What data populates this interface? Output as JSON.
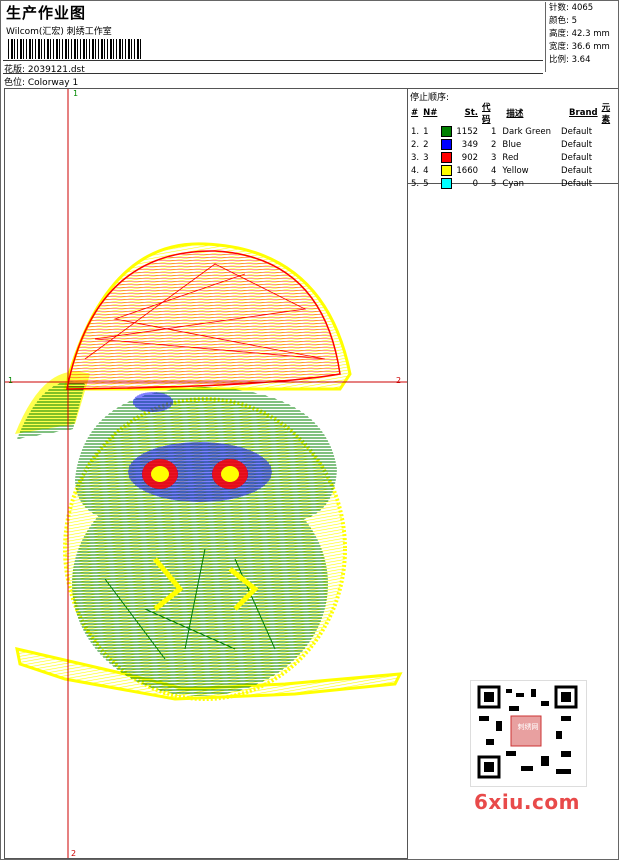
{
  "header": {
    "title": "生产作业图",
    "company": "Wilcom(汇宏) 刺绣工作室",
    "file_label": "花版: 2039121.dst",
    "colorway_label": "色位: Colorway 1"
  },
  "stats": {
    "stitches": "针数: 4065",
    "colors": "颜色: 5",
    "height": "高度: 42.3 mm",
    "width": "宽度: 36.6 mm",
    "scale": "比例: 3.64"
  },
  "stop_sequence": {
    "title": "停止顺序:",
    "headers": [
      "#",
      "N#",
      "St.",
      "代码",
      "描述",
      "Brand",
      "元素"
    ],
    "rows": [
      {
        "idx": "1.",
        "n": "1",
        "color": "#008000",
        "st": "1152",
        "code": "1",
        "desc": "Dark Green",
        "brand": "Default"
      },
      {
        "idx": "2.",
        "n": "2",
        "color": "#0000ff",
        "st": "349",
        "code": "2",
        "desc": "Blue",
        "brand": "Default"
      },
      {
        "idx": "3.",
        "n": "3",
        "color": "#ff0000",
        "st": "902",
        "code": "3",
        "desc": "Red",
        "brand": "Default"
      },
      {
        "idx": "4.",
        "n": "4",
        "color": "#ffff00",
        "st": "1660",
        "code": "4",
        "desc": "Yellow",
        "brand": "Default"
      },
      {
        "idx": "5.",
        "n": "5",
        "color": "#00ffff",
        "st": "0",
        "code": "5",
        "desc": "Cyan",
        "brand": "Default"
      }
    ]
  },
  "axes": {
    "top_label": "1",
    "bottom_label": "2",
    "left_label": "1",
    "right_label": "2"
  },
  "watermark": {
    "site": "6xiu.com",
    "qr_label": "刺绣网"
  },
  "colors": {
    "green": "#008000",
    "blue": "#0000ff",
    "red": "#ff0000",
    "yellow": "#ffff00",
    "axis": "#cc0000"
  }
}
